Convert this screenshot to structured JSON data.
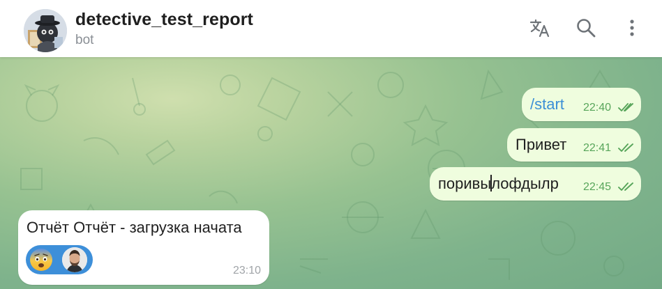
{
  "header": {
    "title": "detective_test_report",
    "subtitle": "bot",
    "actions": {
      "translate_icon": "translate-icon",
      "search_icon": "search-icon",
      "more_icon": "more-vertical-icon"
    }
  },
  "messages_out": [
    {
      "text": "/start",
      "time": "22:40",
      "is_command": true
    },
    {
      "text": "Привет",
      "time": "22:41"
    },
    {
      "text_before_cursor": "поривы",
      "text_after_cursor": "лофдылр",
      "time": "22:45"
    }
  ],
  "message_in": {
    "text": "Отчёт Отчёт - загрузка начата",
    "time": "23:10",
    "reaction": {
      "emoji_icon": "fearful-face-emoji",
      "avatar": "user-avatar"
    }
  },
  "colors": {
    "accent": "#3d8fd9",
    "outgoing_bubble": "#effdde",
    "read_check": "#57a55a",
    "chat_bg": "#97c291"
  }
}
